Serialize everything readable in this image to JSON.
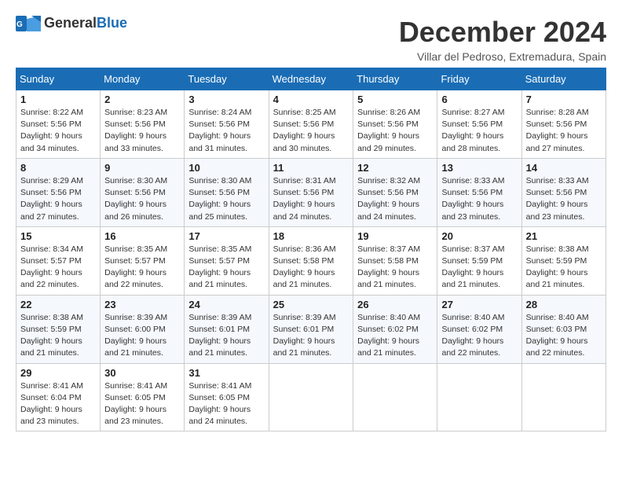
{
  "header": {
    "logo_general": "General",
    "logo_blue": "Blue",
    "month_title": "December 2024",
    "location": "Villar del Pedroso, Extremadura, Spain"
  },
  "calendar": {
    "days_of_week": [
      "Sunday",
      "Monday",
      "Tuesday",
      "Wednesday",
      "Thursday",
      "Friday",
      "Saturday"
    ],
    "weeks": [
      [
        {
          "day": "1",
          "sunrise": "8:22 AM",
          "sunset": "5:56 PM",
          "daylight": "9 hours and 34 minutes."
        },
        {
          "day": "2",
          "sunrise": "8:23 AM",
          "sunset": "5:56 PM",
          "daylight": "9 hours and 33 minutes."
        },
        {
          "day": "3",
          "sunrise": "8:24 AM",
          "sunset": "5:56 PM",
          "daylight": "9 hours and 31 minutes."
        },
        {
          "day": "4",
          "sunrise": "8:25 AM",
          "sunset": "5:56 PM",
          "daylight": "9 hours and 30 minutes."
        },
        {
          "day": "5",
          "sunrise": "8:26 AM",
          "sunset": "5:56 PM",
          "daylight": "9 hours and 29 minutes."
        },
        {
          "day": "6",
          "sunrise": "8:27 AM",
          "sunset": "5:56 PM",
          "daylight": "9 hours and 28 minutes."
        },
        {
          "day": "7",
          "sunrise": "8:28 AM",
          "sunset": "5:56 PM",
          "daylight": "9 hours and 27 minutes."
        }
      ],
      [
        {
          "day": "8",
          "sunrise": "8:29 AM",
          "sunset": "5:56 PM",
          "daylight": "9 hours and 27 minutes."
        },
        {
          "day": "9",
          "sunrise": "8:30 AM",
          "sunset": "5:56 PM",
          "daylight": "9 hours and 26 minutes."
        },
        {
          "day": "10",
          "sunrise": "8:30 AM",
          "sunset": "5:56 PM",
          "daylight": "9 hours and 25 minutes."
        },
        {
          "day": "11",
          "sunrise": "8:31 AM",
          "sunset": "5:56 PM",
          "daylight": "9 hours and 24 minutes."
        },
        {
          "day": "12",
          "sunrise": "8:32 AM",
          "sunset": "5:56 PM",
          "daylight": "9 hours and 24 minutes."
        },
        {
          "day": "13",
          "sunrise": "8:33 AM",
          "sunset": "5:56 PM",
          "daylight": "9 hours and 23 minutes."
        },
        {
          "day": "14",
          "sunrise": "8:33 AM",
          "sunset": "5:56 PM",
          "daylight": "9 hours and 23 minutes."
        }
      ],
      [
        {
          "day": "15",
          "sunrise": "8:34 AM",
          "sunset": "5:57 PM",
          "daylight": "9 hours and 22 minutes."
        },
        {
          "day": "16",
          "sunrise": "8:35 AM",
          "sunset": "5:57 PM",
          "daylight": "9 hours and 22 minutes."
        },
        {
          "day": "17",
          "sunrise": "8:35 AM",
          "sunset": "5:57 PM",
          "daylight": "9 hours and 21 minutes."
        },
        {
          "day": "18",
          "sunrise": "8:36 AM",
          "sunset": "5:58 PM",
          "daylight": "9 hours and 21 minutes."
        },
        {
          "day": "19",
          "sunrise": "8:37 AM",
          "sunset": "5:58 PM",
          "daylight": "9 hours and 21 minutes."
        },
        {
          "day": "20",
          "sunrise": "8:37 AM",
          "sunset": "5:59 PM",
          "daylight": "9 hours and 21 minutes."
        },
        {
          "day": "21",
          "sunrise": "8:38 AM",
          "sunset": "5:59 PM",
          "daylight": "9 hours and 21 minutes."
        }
      ],
      [
        {
          "day": "22",
          "sunrise": "8:38 AM",
          "sunset": "5:59 PM",
          "daylight": "9 hours and 21 minutes."
        },
        {
          "day": "23",
          "sunrise": "8:39 AM",
          "sunset": "6:00 PM",
          "daylight": "9 hours and 21 minutes."
        },
        {
          "day": "24",
          "sunrise": "8:39 AM",
          "sunset": "6:01 PM",
          "daylight": "9 hours and 21 minutes."
        },
        {
          "day": "25",
          "sunrise": "8:39 AM",
          "sunset": "6:01 PM",
          "daylight": "9 hours and 21 minutes."
        },
        {
          "day": "26",
          "sunrise": "8:40 AM",
          "sunset": "6:02 PM",
          "daylight": "9 hours and 21 minutes."
        },
        {
          "day": "27",
          "sunrise": "8:40 AM",
          "sunset": "6:02 PM",
          "daylight": "9 hours and 22 minutes."
        },
        {
          "day": "28",
          "sunrise": "8:40 AM",
          "sunset": "6:03 PM",
          "daylight": "9 hours and 22 minutes."
        }
      ],
      [
        {
          "day": "29",
          "sunrise": "8:41 AM",
          "sunset": "6:04 PM",
          "daylight": "9 hours and 23 minutes."
        },
        {
          "day": "30",
          "sunrise": "8:41 AM",
          "sunset": "6:05 PM",
          "daylight": "9 hours and 23 minutes."
        },
        {
          "day": "31",
          "sunrise": "8:41 AM",
          "sunset": "6:05 PM",
          "daylight": "9 hours and 24 minutes."
        },
        null,
        null,
        null,
        null
      ]
    ]
  }
}
